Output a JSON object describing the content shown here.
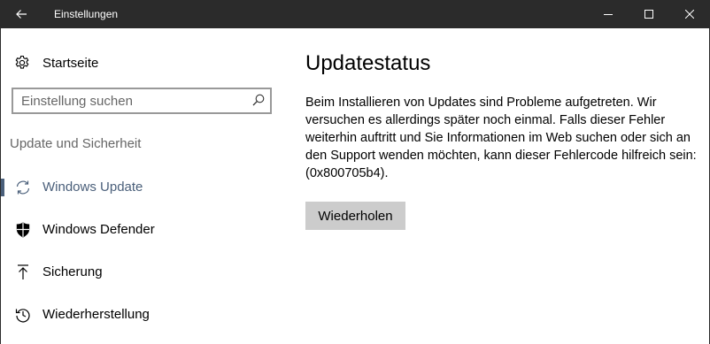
{
  "window": {
    "title": "Einstellungen",
    "back_icon": "back-arrow-icon",
    "controls": [
      "minimize-icon",
      "maximize-icon",
      "close-icon"
    ]
  },
  "sidebar": {
    "home": {
      "label": "Startseite",
      "icon": "gear-icon"
    },
    "search": {
      "placeholder": "Einstellung suchen",
      "value": "",
      "icon": "search-icon"
    },
    "section_label": "Update und Sicherheit",
    "items": [
      {
        "label": "Windows Update",
        "icon": "sync-icon",
        "active": true
      },
      {
        "label": "Windows Defender",
        "icon": "shield-icon",
        "active": false
      },
      {
        "label": "Sicherung",
        "icon": "backup-arrow-icon",
        "active": false
      },
      {
        "label": "Wiederherstellung",
        "icon": "history-icon",
        "active": false
      }
    ]
  },
  "main": {
    "heading": "Updatestatus",
    "message": "Beim Installieren von Updates sind Probleme aufgetreten. Wir versuchen es allerdings später noch einmal. Falls dieser Fehler weiterhin auftritt und Sie Informationen im Web suchen oder sich an den Support wenden möchten, kann dieser Fehlercode hilfreich sein: (0x800705b4).",
    "retry_label": "Wiederholen"
  },
  "colors": {
    "titlebar": "#2b2b2b",
    "accent": "#4a5f7a",
    "button": "#cccccc",
    "muted_text": "#666666"
  }
}
